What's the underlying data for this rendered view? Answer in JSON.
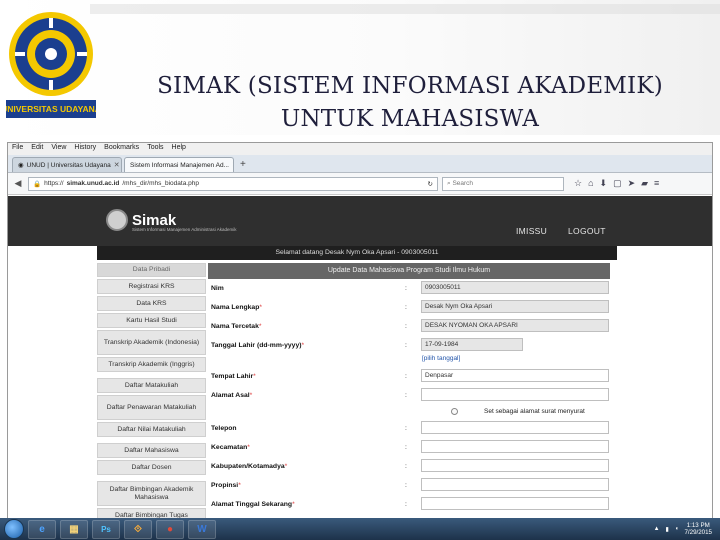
{
  "slide": {
    "logo_text": "UNIVERSITAS UDAYANA",
    "title_line1": "SIMAK (SISTEM INFORMASI AKADEMIK)",
    "title_line2": "UNTUK MAHASISWA"
  },
  "browser": {
    "menu": [
      "File",
      "Edit",
      "View",
      "History",
      "Bookmarks",
      "Tools",
      "Help"
    ],
    "tabs": [
      {
        "label": "UNUD | Universitas Udayana"
      },
      {
        "label": "Sistem Informasi Manajemen Ad..."
      }
    ],
    "url_scheme": "https://",
    "url_host": "simak.unud.ac.id",
    "url_path": "/mhs_dir/mhs_biodata.php",
    "search_placeholder": "Search"
  },
  "site": {
    "brand": "Simak",
    "tagline": "Sistem Informasi Manajemen Administrasi Akademik",
    "nav": [
      "IMISSU",
      "LOGOUT"
    ],
    "welcome": "Selamat datang Desak Nym Oka Apsari - 0903005011"
  },
  "sidebar": {
    "items": [
      "Data Pribadi",
      "Registrasi KRS",
      "Data KRS",
      "Kartu Hasil Studi",
      "Transkrip Akademik (Indonesia)",
      "Transkrip Akademik (Inggris)",
      "Daftar Matakuliah",
      "Daftar Penawaran Matakuliah",
      "Daftar Nilai Matakuliah",
      "Daftar Mahasiswa",
      "Daftar Dosen",
      "Daftar Bimbingan Akademik Mahasiswa",
      "Daftar Bimbingan Tugas"
    ]
  },
  "form": {
    "title": "Update Data Mahasiswa Program Studi Ilmu Hukum",
    "colon": ":",
    "rows": [
      {
        "label": "Nim",
        "value": "0903005011"
      },
      {
        "label": "Nama Lengkap",
        "value": "Desak Nym Oka Apsari"
      },
      {
        "label": "Nama Tercetak",
        "value": "DESAK NYOMAN OKA APSARI"
      },
      {
        "label": "Tanggal Lahir (dd-mm-yyyy)",
        "value": "17-09-1984"
      },
      {
        "label": "Tempat Lahir",
        "value": "Denpasar"
      },
      {
        "label": "Alamat Asal",
        "value": ""
      },
      {
        "label": "Telepon",
        "value": ""
      },
      {
        "label": "Kecamatan",
        "value": ""
      },
      {
        "label": "Kabupaten/Kotamadya",
        "value": ""
      },
      {
        "label": "Propinsi",
        "value": ""
      },
      {
        "label": "Alamat Tinggal Sekarang",
        "value": ""
      }
    ],
    "required_mark": "*",
    "date_picker": "[pilih tanggal]",
    "set_address": "Set sebagai alamat surat menyurat"
  },
  "taskbar": {
    "apps": [
      "e",
      "▦",
      "Ps",
      "⟐",
      "●",
      "W"
    ],
    "time": "1:13 PM",
    "date": "7/29/2015"
  },
  "colors": {
    "title": "#1f1f3b",
    "header_bg": "#2f2f2f",
    "form_title_bg": "#666666",
    "link": "#2255aa"
  }
}
